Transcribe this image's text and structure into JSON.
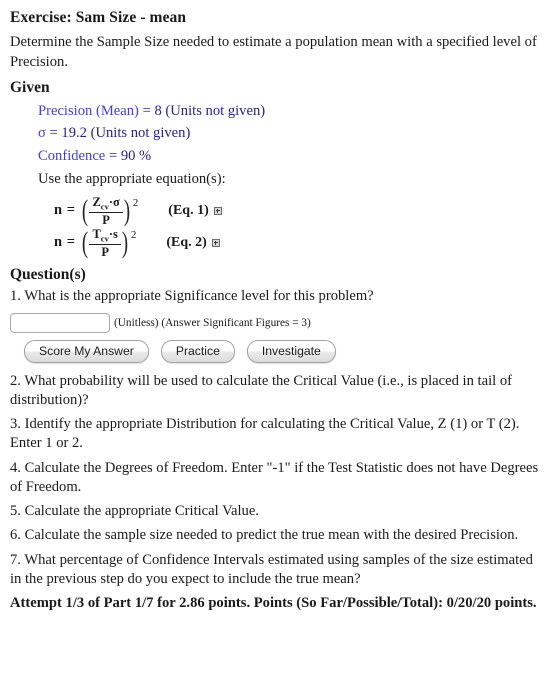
{
  "exercise": {
    "title": "Exercise: Sam Size - mean",
    "description": "Determine the Sample Size needed to estimate a population mean with a specified level of Precision."
  },
  "given": {
    "heading": "Given",
    "items": [
      {
        "label": "Precision (Mean)",
        "value": "= 8 (Units not given)"
      },
      {
        "label": "σ",
        "value": "= 19.2 (Units not given)"
      },
      {
        "label": "Confidence",
        "value": "= 90 %"
      }
    ],
    "use_equations_text": "Use the appropriate equation(s):",
    "equations": [
      {
        "lhs": "n =",
        "numerator_base": "Z",
        "numerator_sub": "cv",
        "numerator_rest": "·σ",
        "denominator": "P",
        "exponent": "2",
        "label": "(Eq. 1)",
        "icon": "expand-icon"
      },
      {
        "lhs": "n =",
        "numerator_base": "T",
        "numerator_sub": "cv",
        "numerator_rest": "·s",
        "denominator": "P",
        "exponent": "2",
        "label": "(Eq. 2)",
        "icon": "expand-icon"
      }
    ]
  },
  "questions": {
    "heading": "Question(s)",
    "items": [
      "1. What is the appropriate Significance level for this problem?",
      "2. What probability will be used to calculate the Critical Value (i.e., is placed in tail of distribution)?",
      "3. Identify the appropriate Distribution for calculating the Critical Value, Z (1) or T (2). Enter 1 or 2.",
      "4. Calculate the Degrees of Freedom. Enter \"-1\" if the Test Statistic does not have Degrees of Freedom.",
      "5. Calculate the appropriate Critical Value.",
      "6. Calculate the sample size needed to predict the true mean with the desired Precision.",
      "7. What percentage of Confidence Intervals estimated using samples of the size estimated in the previous step do you expect to include the true mean?"
    ]
  },
  "answer": {
    "value": "",
    "placeholder": "",
    "hint": "(Unitless) (Answer Significant Figures = 3)"
  },
  "buttons": [
    {
      "label": "Score My Answer",
      "name": "score-my-answer-button"
    },
    {
      "label": "Practice",
      "name": "practice-button"
    },
    {
      "label": "Investigate",
      "name": "investigate-button"
    }
  ],
  "footer": {
    "attempt_text": "Attempt 1/3 of Part 1/7 for 2.86 points. Points (So Far/Possible/Total): 0/20/20 points."
  },
  "colors": {
    "given_label": "#4040dd",
    "given_value": "#23238e",
    "text": "#1a1a1a",
    "input_border": "#a9a9a9",
    "button_border": "#a2a2a2"
  }
}
